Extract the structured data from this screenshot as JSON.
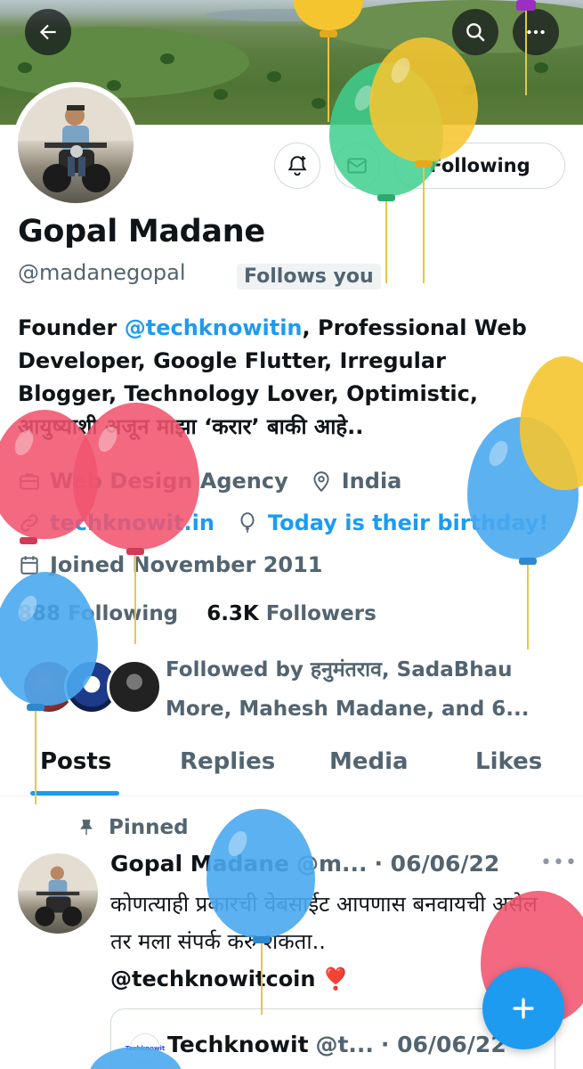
{
  "profile": {
    "name": "Gopal Madane",
    "handle": "@madanegopal",
    "follows_you": "Follows you",
    "bio_prefix": "Founder ",
    "bio_mention": "@techknowitin",
    "bio_rest": ", Professional Web Developer, Google Flutter, Irregular Blogger, Technology Lover, Optimistic, आयुष्याशी अजून माझा ‘करार’ बाकी आहे..",
    "category": "Web Design Agency",
    "location": "India",
    "website": "techknowit.in",
    "birthday": "Today is their birthday!",
    "joined": "Joined November 2011",
    "following_count": "888",
    "following_label": "Following",
    "followers_count": "6.3K",
    "followers_label": "Followers",
    "followed_by": "Followed by हनुमंतराव, SadaBhau More, Mahesh Madane, and 6..."
  },
  "actions": {
    "following_label": "Following"
  },
  "tabs": [
    {
      "label": "Posts",
      "active": true
    },
    {
      "label": "Replies",
      "active": false
    },
    {
      "label": "Media",
      "active": false
    },
    {
      "label": "Likes",
      "active": false
    }
  ],
  "pinned_post": {
    "pinned_label": "Pinned",
    "author_name": "Gopal Madane",
    "author_handle": "@m...",
    "date": "· 06/06/22",
    "text": "कोणत्याही प्रकारची वेबसाईट आपणास बनवायची असेल तर मला संपर्क करु शकता..",
    "tag": "@techknowitcoin",
    "emoji": "❣️",
    "quote": {
      "name": "Techknowit",
      "handle": "@t...",
      "date": "· 06/06/22",
      "logo_text": "Techknowit"
    }
  },
  "followed_avatars": [
    "avatar-1",
    "avatar-2",
    "avatar-3"
  ],
  "colors": {
    "accent": "#1d9bf0",
    "text": "#0f1419",
    "secondary": "#536471",
    "balloon_red": "#f0546e",
    "balloon_blue": "#4aa9f0",
    "balloon_yellow": "#f5c530",
    "balloon_green": "#3ecf8e"
  },
  "icons": [
    "back-arrow-icon",
    "search-icon",
    "more-icon",
    "notification-bell-icon",
    "mail-icon",
    "briefcase-icon",
    "location-pin-icon",
    "link-icon",
    "balloon-icon",
    "calendar-icon",
    "pin-icon",
    "plus-icon"
  ]
}
